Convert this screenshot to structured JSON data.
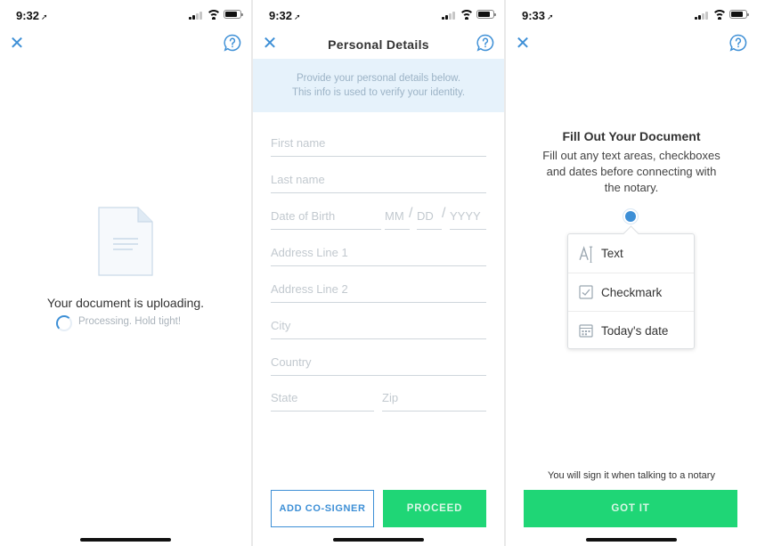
{
  "screens": [
    {
      "status": {
        "time": "9:32",
        "location_glyph": "➚"
      },
      "icons": {
        "close": "close-icon",
        "help": "help-icon",
        "document": "document-icon",
        "spinner": "spinner-icon"
      },
      "upload_title": "Your document is uploading.",
      "processing_text": "Processing. Hold tight!",
      "progress": 0.25
    },
    {
      "status": {
        "time": "9:32",
        "location_glyph": "➚"
      },
      "title": "Personal Details",
      "banner_line1": "Provide your personal details below.",
      "banner_line2": "This info is used to verify your identity.",
      "fields": {
        "first_name": "First name",
        "last_name": "Last name",
        "dob": "Date of Birth",
        "mm": "MM",
        "dd": "DD",
        "yyyy": "YYYY",
        "address1": "Address Line 1",
        "address2": "Address Line 2",
        "city": "City",
        "country": "Country",
        "state": "State",
        "zip": "Zip"
      },
      "add_cosigner_label": "ADD CO-SIGNER",
      "proceed_label": "PROCEED"
    },
    {
      "status": {
        "time": "9:33",
        "location_glyph": "➚"
      },
      "title": "Fill Out Your Document",
      "desc_line1": "Fill out any text areas, checkboxes",
      "desc_line2": "and dates before connecting with",
      "desc_line3": "the notary.",
      "menu": [
        {
          "label": "Text",
          "icon": "text-field-icon"
        },
        {
          "label": "Checkmark",
          "icon": "checkbox-icon"
        },
        {
          "label": "Today's date",
          "icon": "calendar-icon"
        }
      ],
      "sign_note": "You will sign it when talking to a notary",
      "got_it_label": "GOT IT"
    }
  ],
  "colors": {
    "accent_blue": "#3d8fd6",
    "green": "#1fd676",
    "banner_bg": "#e6f2fb",
    "placeholder": "#c2c9cf"
  }
}
